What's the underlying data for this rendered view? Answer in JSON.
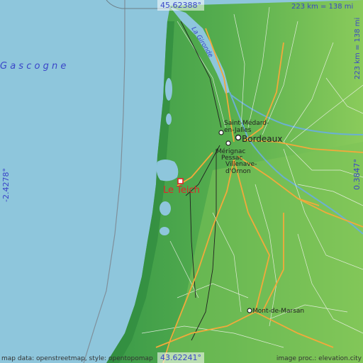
{
  "coords": {
    "top_lat": "45.62388°",
    "bottom_lat": "43.62241°",
    "left_lon": "-2.4278°",
    "right_lon": "0.3847°"
  },
  "scale": {
    "top": "223 km = 138 mi",
    "right": "223 km = 138 mi"
  },
  "labels": {
    "sea": "G a s c o g n e",
    "river": "La Gironde",
    "saint_medard": [
      "Saint-Médard-",
      "en-Jalles"
    ],
    "bordeaux": "Bordeaux",
    "merignac": "Mérignac",
    "pessac": "Pessac",
    "villenave": [
      "Villenave-",
      "d'Ornon"
    ],
    "le_teich": "Le Teich",
    "mont_de_marsan": "Mont-de-Marsan"
  },
  "attribution": {
    "left": "map data: openstreetmap, style: opentopomap",
    "right": "image proc.: elevation.city"
  },
  "colors": {
    "sea": "#8ec6dc",
    "land_dark": "#3f9a45",
    "land_light": "#6fbd55",
    "highlight": "#e0242a",
    "coord_text": "#3a46c8"
  }
}
